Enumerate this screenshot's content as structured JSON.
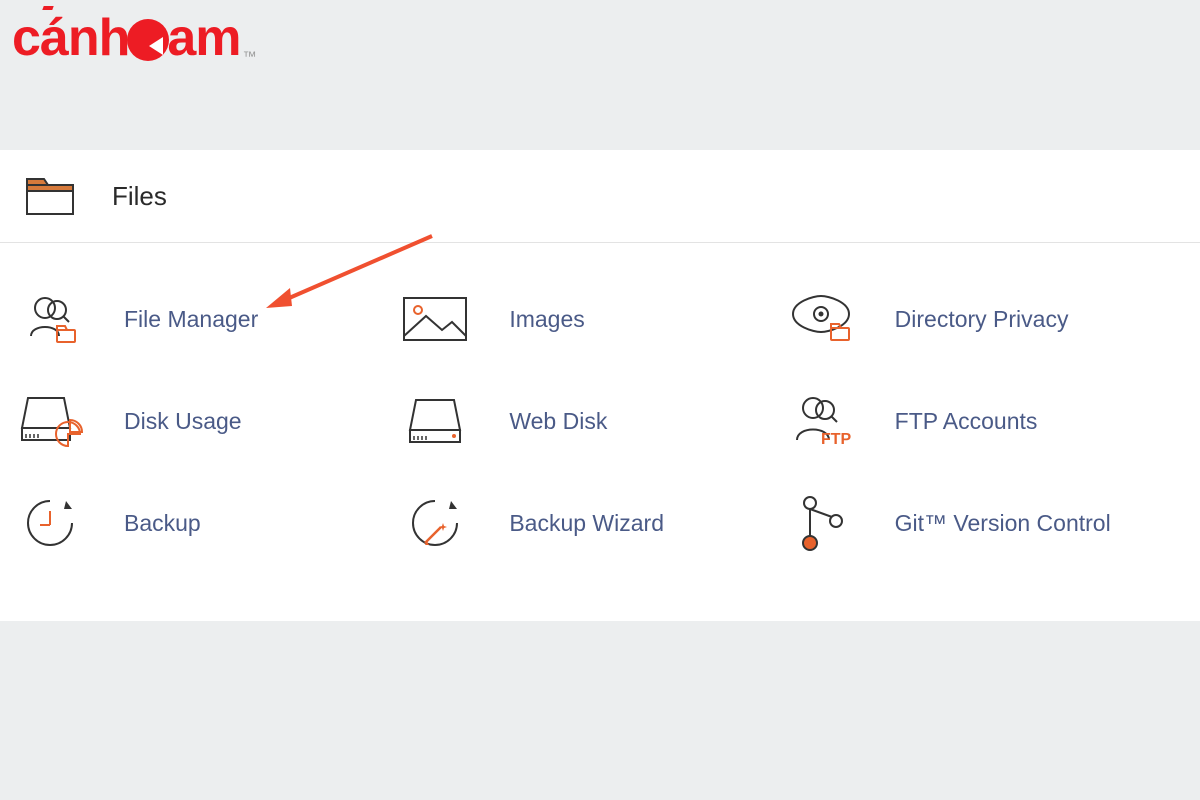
{
  "brand": {
    "name": "cánheam",
    "trademark": "™"
  },
  "section": {
    "title": "Files"
  },
  "items": [
    {
      "id": "file-manager",
      "label": "File Manager"
    },
    {
      "id": "images",
      "label": "Images"
    },
    {
      "id": "directory-privacy",
      "label": "Directory Privacy"
    },
    {
      "id": "disk-usage",
      "label": "Disk Usage"
    },
    {
      "id": "web-disk",
      "label": "Web Disk"
    },
    {
      "id": "ftp-accounts",
      "label": "FTP Accounts"
    },
    {
      "id": "backup",
      "label": "Backup"
    },
    {
      "id": "backup-wizard",
      "label": "Backup Wizard"
    },
    {
      "id": "git-version",
      "label": "Git™ Version Control"
    }
  ],
  "annotation": {
    "target": "file-manager"
  }
}
